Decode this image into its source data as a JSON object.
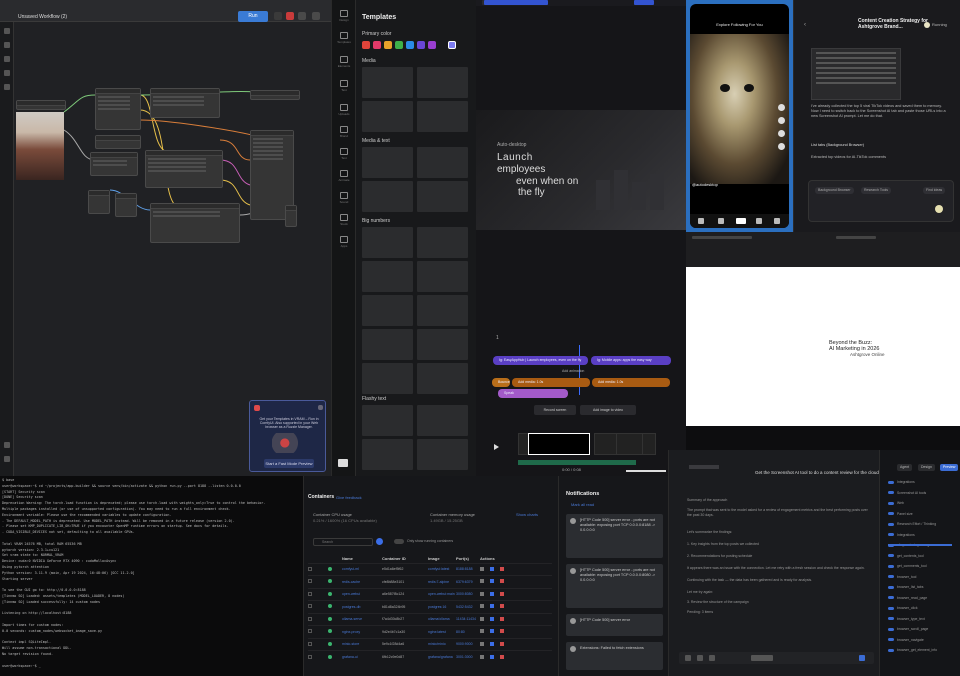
{
  "workflow": {
    "title": "Unsaved Workflow (2)",
    "run_label": "Run",
    "popup_text": "Get your Templates in VRAM – Run in ComfyUI. Also supported in your Web browser as a Ruzzle Manager.",
    "popup_button": "Start a Fast Mode Preview"
  },
  "templates": {
    "title": "Templates",
    "primary_color_label": "Primary color",
    "swatches": [
      "#e0443a",
      "#e23a6a",
      "#e8a22a",
      "#3fb14a",
      "#2b8be8",
      "#6a46d6",
      "#9a3ed0",
      "#7b7bf0"
    ],
    "sections": [
      "Media",
      "Media & text",
      "Big numbers",
      "Flashy text"
    ],
    "side_items": [
      "Design",
      "Templates",
      "Elements",
      "Text",
      "Uploads",
      "Brand",
      "Text",
      "Animate",
      "Sound",
      "Stock",
      "Apps"
    ]
  },
  "video": {
    "preview_line1": "Auto-desktop",
    "preview_line2": "Launch",
    "preview_line3": "employees",
    "preview_line4": "even when on",
    "preview_line5": "the fly",
    "clip1": "Ig: EasyAppHub | Launch employees, even on the fly",
    "clip2": "Ig: Mobile apps: apps the easy way",
    "clip3": "Add animation",
    "clip4": "Bounce",
    "clip5": "Add media: 1.0s",
    "clip6": "Add media: 1.0s",
    "clip7": "Speak",
    "btn_record": "Record screen",
    "btn_add": "Add image to video",
    "timecode": "0:00 / 0:08"
  },
  "phone": {
    "nav_tabs": "Explore   Following   For You",
    "handle": "@autodesktop"
  },
  "chat": {
    "title": "Content Creation Strategy for Ashtgrove Brand...",
    "badge": "Running",
    "msg1": "I've already collected the top 5 viral TikTok videos and saved them to memory. Now I need to switch back to the Screenshot AI tab and paste those URLs into a new Screenshot AI prompt. Let me do that.",
    "msg2": "List tabs (Background Browser)",
    "msg3": "Extracted top videos for AI-TikTok comments",
    "pill1": "Background Browser",
    "pill2": "Research Tools",
    "pill3": "Find ideas"
  },
  "slide": {
    "title_line1": "Beyond the Buzz:",
    "title_line2": "AI Marketing in 2026",
    "subtitle": "Ashtgrove Online"
  },
  "terminal": {
    "lines": [
      "$ base",
      "user@workspace:~$ cd ~/projects/app-builder && source venv/bin/activate && python run.py --port 8188 --listen 0.0.0.0",
      "[START] Security scan",
      "[DONE] Security scan",
      "Deprecation Warning: The torch.load function is deprecated; please use torch.load with weights_only=True to control the behavior.",
      "Multiple packages installed (or use of unsupported configuration). You may need to run a full environment check.",
      "Environment variable: Please use the recommended variables to update configuration.",
      "  - The DEFAULT_MODEL_PATH is deprecated. Use MODEL_PATH instead. Will be removed in a future release (version 2.0).",
      "  - Please set KMP_DUPLICATE_LIB_OK=TRUE if you encounter OpenMP runtime errors on startup. See docs for details.",
      "  - CUDA_VISIBLE_DEVICES not set, defaulting to all available GPUs.",
      "",
      "Total VRAM 24576 MB, total RAM 65536 MB",
      "pytorch version: 2.3.1+cu121",
      "Set vram state to: NORMAL_VRAM",
      "Device: cuda:0 NVIDIA GeForce RTX 4090 : cudaMallocAsync",
      "Using pytorch attention",
      "Python version: 3.11.9 (main, Apr 19 2024, 16:48:06) [GCC 11.2.0]",
      "Starting server",
      "",
      "To see the GUI go to: http://0.0.0.0:8188",
      "[Tinnmo SO]  Loaded: assets/templates (MODEL_LOADER, 8 nodes)",
      "[Tinnmo SO]  Loaded successfully: 14 custom nodes",
      "",
      "Listening on http://localhost:8188",
      "",
      "Import times for custom nodes:",
      "  0.0 seconds: custom_nodes/websocket_image_save.py",
      "",
      "Context impl SQLiteImpl.",
      "Will assume non-transactional DDL.",
      "No target revision found.",
      "",
      "user@workspace:~$ _"
    ]
  },
  "containers": {
    "title": "Containers",
    "feedback": "Give feedback",
    "cpu_label": "Container CPU usage",
    "cpu_value": "0.21% / 1600% (16 CPUs available)",
    "mem_label": "Container memory usage",
    "mem_value": "1.49GB / 15.25GB",
    "show_charts": "Show charts",
    "search_placeholder": "Search",
    "only_running": "Only show running containers",
    "headers": [
      "",
      "Name",
      "Container ID",
      "Image",
      "Port(s)",
      "Actions"
    ],
    "rows": [
      [
        "comfyui-ml",
        "e5d1a6ef5f62",
        "comfyui:latest",
        "8188:8188"
      ],
      [
        "redis-cache",
        "cfe8b88e3101",
        "redis:7-alpine",
        "6379:6379"
      ],
      [
        "open-webui",
        "a6e587f8c124",
        "open-webui:main",
        "3000:8080"
      ],
      [
        "postgres-db",
        "b81d8a324b95",
        "postgres:16",
        "5432:5432"
      ],
      [
        "ollama-serve",
        "f7a4d30c8b27",
        "ollama/ollama",
        "11434:11434"
      ],
      [
        "nginx-proxy",
        "9d2e4b7c1a30",
        "nginx:latest",
        "80:80"
      ],
      [
        "minio-store",
        "5e9c1f28d4a6",
        "minio/minio",
        "9000:9000"
      ],
      [
        "grafana-ui",
        "6fb12c9e0d87",
        "grafana/grafana",
        "3001:3000"
      ]
    ]
  },
  "notifications": {
    "title": "Notifications",
    "mark_read": "Mark all read",
    "cards": [
      "[HTTP Code 500] server error - ports are not available: exposing port TCP 0.0.0.0:8188 -> 0.0.0.0:0",
      "[HTTP Code 500] server error - ports are not available: exposing port TCP 0.0.0.0:8080 -> 0.0.0.0:0",
      "[HTTP Code 500] server error",
      "Extensions: Failed to fetch extensions"
    ]
  },
  "docs": {
    "doc_title": "Get the Screenshot AI tool to do a content review for the cloud.",
    "lines": [
      "Summary of the approach",
      "The prompt that was sent to the model asked for a review of engagement metrics and the best performing posts over the past 30 days.",
      "Let's summarize the findings:",
      "1. Key insights from the top posts we collected",
      "2. Recommendations for posting schedule",
      "It appears there was an issue with the connection. Let me retry with a fresh session and check the response again.",
      "Continuing with the task — the data has been gathered and is ready for analysis.",
      "Let me try again:",
      "3. Review the structure of the campaign",
      "Pending: 3 items"
    ],
    "tabs": [
      "Agent",
      "Design",
      "Preview"
    ],
    "right_items": [
      "Integrations",
      "Screenshot AI tools",
      "Web",
      "Panel size",
      "Research Effort / Thinking",
      "Integrations",
      "site_contents_manager",
      "get_contents_tool",
      "get_comments_tool",
      "browser_tool",
      "browser_list_tabs",
      "browser_read_page",
      "browser_click",
      "browser_type_text",
      "browser_scroll_page",
      "browser_navigate",
      "browser_get_element_info"
    ]
  }
}
